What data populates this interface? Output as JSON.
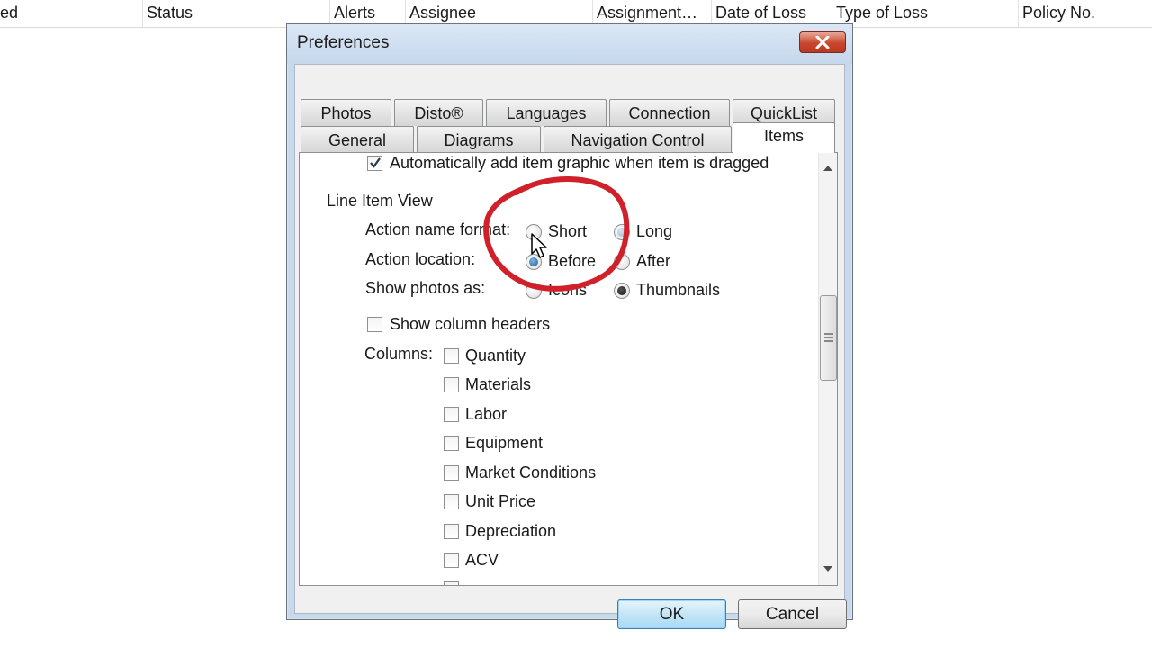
{
  "list_header": {
    "columns": [
      "ed",
      "Status",
      "Alerts",
      "Assignee",
      "Assignment…",
      "Date of Loss",
      "Type of Loss",
      "Policy No."
    ]
  },
  "dialog": {
    "title": "Preferences",
    "tabs_row1": [
      "Photos",
      "Disto®",
      "Languages",
      "Connection",
      "QuickList"
    ],
    "tabs_row2": [
      "General",
      "Diagrams",
      "Navigation Control",
      "Items"
    ],
    "active_tab": "Items",
    "auto_add_graphic": {
      "label": "Automatically add item graphic when item is dragged",
      "checked": true
    },
    "line_item_view": {
      "heading": "Line Item View",
      "action_name_format": {
        "label": "Action name format:",
        "options": [
          "Short",
          "Long"
        ],
        "selected": "Long"
      },
      "action_location": {
        "label": "Action location:",
        "options": [
          "Before",
          "After"
        ],
        "selected": "Before"
      },
      "show_photos_as": {
        "label": "Show photos as:",
        "options": [
          "Icons",
          "Thumbnails"
        ],
        "selected": "Thumbnails"
      },
      "show_column_headers": {
        "label": "Show column headers",
        "checked": false
      },
      "columns_label": "Columns:",
      "columns": [
        "Quantity",
        "Materials",
        "Labor",
        "Equipment",
        "Market Conditions",
        "Unit Price",
        "Depreciation",
        "ACV"
      ]
    },
    "ok_label": "OK",
    "cancel_label": "Cancel"
  },
  "colors": {
    "annotation": "#d0202a",
    "dialog_frame": "#c9d9ec",
    "ok_button": "#c4e5f6"
  },
  "icons": [
    "close-icon",
    "checkmark-icon",
    "scroll-up-arrow-icon",
    "scroll-down-arrow-icon",
    "mouse-pointer-icon"
  ]
}
